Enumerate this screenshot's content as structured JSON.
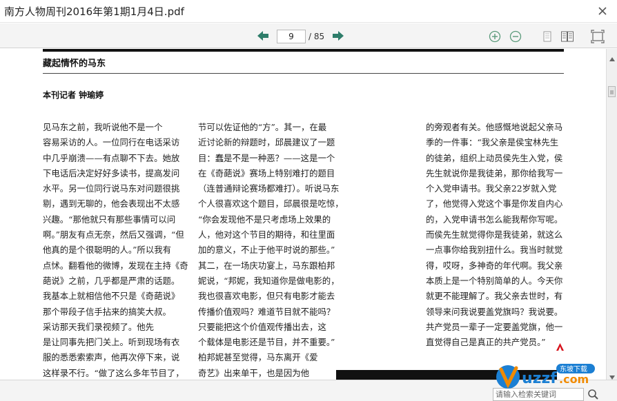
{
  "window": {
    "title": "南方人物周刊2016年第1期1月4日.pdf"
  },
  "toolbar": {
    "current_page": "9",
    "total_pages": "/ 85"
  },
  "article": {
    "title": "藏起情怀的马东",
    "byline": "本刊记者  钟瑜婷",
    "column1": [
      "    见马东之前，我听说他不是一个",
      "容易采访的人。一位同行在电话采访",
      "中几乎崩溃——有点聊不下去。她放",
      "下电话后决定好好多读书，提高发问",
      "水平。另一位同行说马东对问题很挑",
      "剔，遇到无聊的，他会表现出不太感",
      "兴趣。“那他就只有那些事情可以问",
      "啊。”朋友有点无奈，然后又强调，“但",
      "他真的是个很聪明的人。”所以我有",
      "点怵。翻看他的微博，发现在主持《奇",
      "葩说》之前，几乎都是严肃的话题。",
      "我基本上就相信他不只是《奇葩说》",
      "那个带段子信手拈来的搞笑大叔。",
      "    采访那天我们录视频了。他先",
      "是让同事先把门关上。听到现场有衣",
      "服的悉悉索索声，他再次停下来，说",
      "这样录不行。“做了这么多年节目了，"
    ],
    "column2": [
      "节可以佐证他的“方”。其一，在最",
      "近讨论新的辩题时，邱晨建议了一题",
      "目：蠢是不是一种恶？——这是一个",
      "在《奇葩说》赛场上特别难打的题目",
      "（连普通辩论赛场都难打）。听说马东",
      "个人很喜欢这个题目，邱晨很是吃惊，",
      "“你会发现他不是只考虑场上效果的",
      "人，他对这个节目的期待，和往里面",
      "加的意义，不止于他平时说的那些。”",
      "其二，在一场庆功宴上，马东跟柏邦",
      "妮说，“邦妮，我知道你是做电影的，",
      "我也很喜欢电影，但只有电影才能去",
      "传播价值观吗？难道节目就不能吗？",
      "只要能把这个价值观传播出去，这",
      "个载体是电影还是节目，并不重要。”",
      "柏邦妮甚至觉得，马东离开《爱",
      "奇艺》出来单干，也是因为他"
    ],
    "column3": [
      "的旁观者有关。他感慨地说起父亲马",
      "季的一件事：“我父亲是侯宝林先生",
      "的徒弟，组织上动员侯先生入党，侯",
      "先生就说你是我徒弟，那你给我写一",
      "个入党申请书。我父亲22岁就入党",
      "了，他觉得入党这个事是你发自内心",
      "的，入党申请书怎么能我帮你写呢。",
      "而侯先生就觉得你是我徒弟，就这么",
      "一点事你给我别扭什么。我当时就觉",
      "得，哎呀，多神奇的年代啊。我父亲",
      "本质上是一个特别简单的人。今天你",
      "就更不能理解了。我父亲去世时，有",
      "领导来问我说要盖党旗吗？我说要。",
      "共产党员一辈子一定要盖党旗，他一",
      "直觉得自己是真正的共产党员。”"
    ]
  },
  "statusbar": {
    "search_placeholder": "请输入检索关键词"
  },
  "watermark": {
    "brand": "uzzf.com",
    "tagline": "东坡下载"
  },
  "colors": {
    "nav_arrow": "#2e7d6a",
    "tool_icon": "#5a9a7a",
    "accent_red": "#d7121c",
    "watermark_blue": "#1b7fd3",
    "watermark_orange": "#f08a00"
  }
}
